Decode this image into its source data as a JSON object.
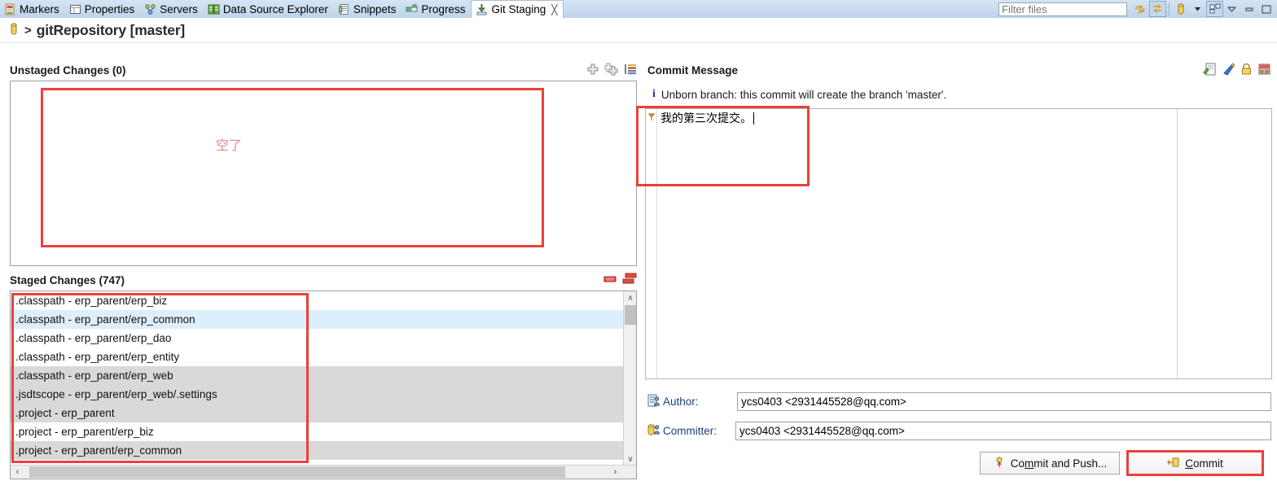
{
  "window": {
    "tabs": [
      {
        "label": "Markers",
        "icon": "markers-icon",
        "active": false
      },
      {
        "label": "Properties",
        "icon": "properties-icon",
        "active": false
      },
      {
        "label": "Servers",
        "icon": "servers-icon",
        "active": false
      },
      {
        "label": "Data Source Explorer",
        "icon": "data-source-explorer-icon",
        "active": false
      },
      {
        "label": "Snippets",
        "icon": "snippets-icon",
        "active": false
      },
      {
        "label": "Progress",
        "icon": "progress-icon",
        "active": false
      },
      {
        "label": "Git Staging",
        "icon": "git-staging-icon",
        "active": true
      }
    ],
    "tab_close_glyph": "╳",
    "toolbar": {
      "filter_value": "",
      "filter_placeholder": "Filter files",
      "icons": [
        "refresh-icon",
        "link-selection-icon",
        "repository-icon",
        "dropdown-arrow-icon",
        "presentation-icon",
        "view-menu-icon",
        "minimize-icon",
        "maximize-icon"
      ]
    }
  },
  "breadcrumb": {
    "icon": "repository-icon",
    "separator": ">",
    "title": "gitRepository [master]"
  },
  "unstaged": {
    "title": "Unstaged Changes (0)",
    "tools": [
      "stage-selected-icon",
      "stage-all-icon",
      "presentation-menu-icon"
    ],
    "items": []
  },
  "staged": {
    "title": "Staged Changes (747)",
    "tools": [
      "unstage-selected-icon",
      "unstage-all-icon"
    ],
    "items": [
      {
        "label": ".classpath - erp_parent/erp_biz",
        "style": ""
      },
      {
        "label": ".classpath - erp_parent/erp_common",
        "style": "sel"
      },
      {
        "label": ".classpath - erp_parent/erp_dao",
        "style": ""
      },
      {
        "label": ".classpath - erp_parent/erp_entity",
        "style": ""
      },
      {
        "label": ".classpath - erp_parent/erp_web",
        "style": "alt"
      },
      {
        "label": ".jsdtscope - erp_parent/erp_web/.settings",
        "style": "alt"
      },
      {
        "label": ".project - erp_parent",
        "style": "alt"
      },
      {
        "label": ".project - erp_parent/erp_biz",
        "style": ""
      },
      {
        "label": ".project - erp_parent/erp_common",
        "style": "alt"
      }
    ]
  },
  "commit": {
    "title": "Commit Message",
    "tools": [
      "amend-commit-icon",
      "signed-off-icon",
      "sign-commit-icon",
      "add-change-id-icon"
    ],
    "info_icon": "info-icon",
    "info_text": "Unborn branch: this commit will create the branch 'master'.",
    "message": "我的第三次提交。",
    "author_label": "Author:",
    "author_icon": "author-icon",
    "author_value": "ycs0403 <2931445528@qq.com>",
    "committer_label": "Committer:",
    "committer_icon": "committer-icon",
    "committer_value": "ycs0403 <2931445528@qq.com>",
    "commit_push_label": "Commit and Push...",
    "commit_push_icon": "push-icon",
    "commit_label": "Commit",
    "commit_icon": "commit-icon"
  },
  "annotations": {
    "empty_note": "空了",
    "color": "#e8413c",
    "note_color": "#e08b8b"
  },
  "scroll": {
    "up_glyph": "∧",
    "down_glyph": "∨",
    "left_glyph": "‹",
    "right_glyph": "›"
  }
}
